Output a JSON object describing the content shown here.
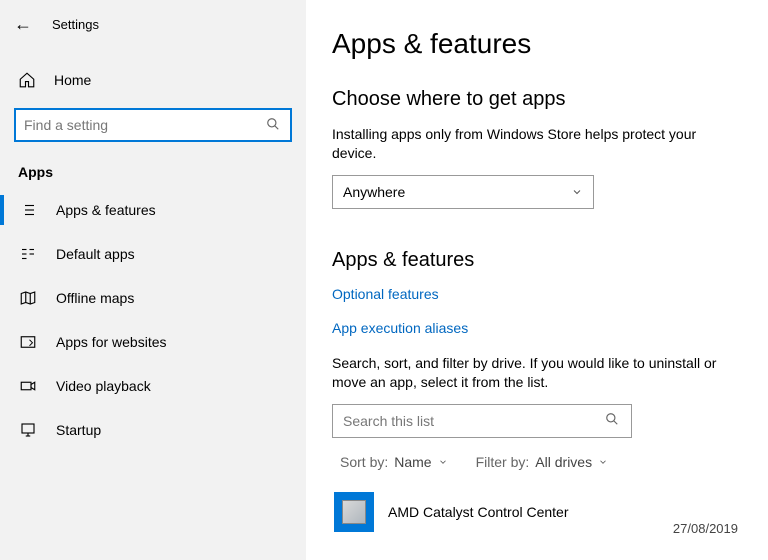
{
  "window": {
    "title": "Settings"
  },
  "sidebar": {
    "home": "Home",
    "search_placeholder": "Find a setting",
    "section": "Apps",
    "items": [
      {
        "label": "Apps & features",
        "active": true
      },
      {
        "label": "Default apps"
      },
      {
        "label": "Offline maps"
      },
      {
        "label": "Apps for websites"
      },
      {
        "label": "Video playback"
      },
      {
        "label": "Startup"
      }
    ]
  },
  "main": {
    "heading": "Apps & features",
    "section1_heading": "Choose where to get apps",
    "section1_text": "Installing apps only from Windows Store helps protect your device.",
    "source_dropdown": "Anywhere",
    "section2_heading": "Apps & features",
    "link_optional": "Optional features",
    "link_aliases": "App execution aliases",
    "filter_text": "Search, sort, and filter by drive. If you would like to uninstall or move an app, select it from the list.",
    "list_search_placeholder": "Search this list",
    "sort_label": "Sort by:",
    "sort_value": "Name",
    "filter_label": "Filter by:",
    "filter_value": "All drives",
    "apps": [
      {
        "name": "AMD Catalyst Control Center",
        "date": "27/08/2019"
      }
    ]
  }
}
